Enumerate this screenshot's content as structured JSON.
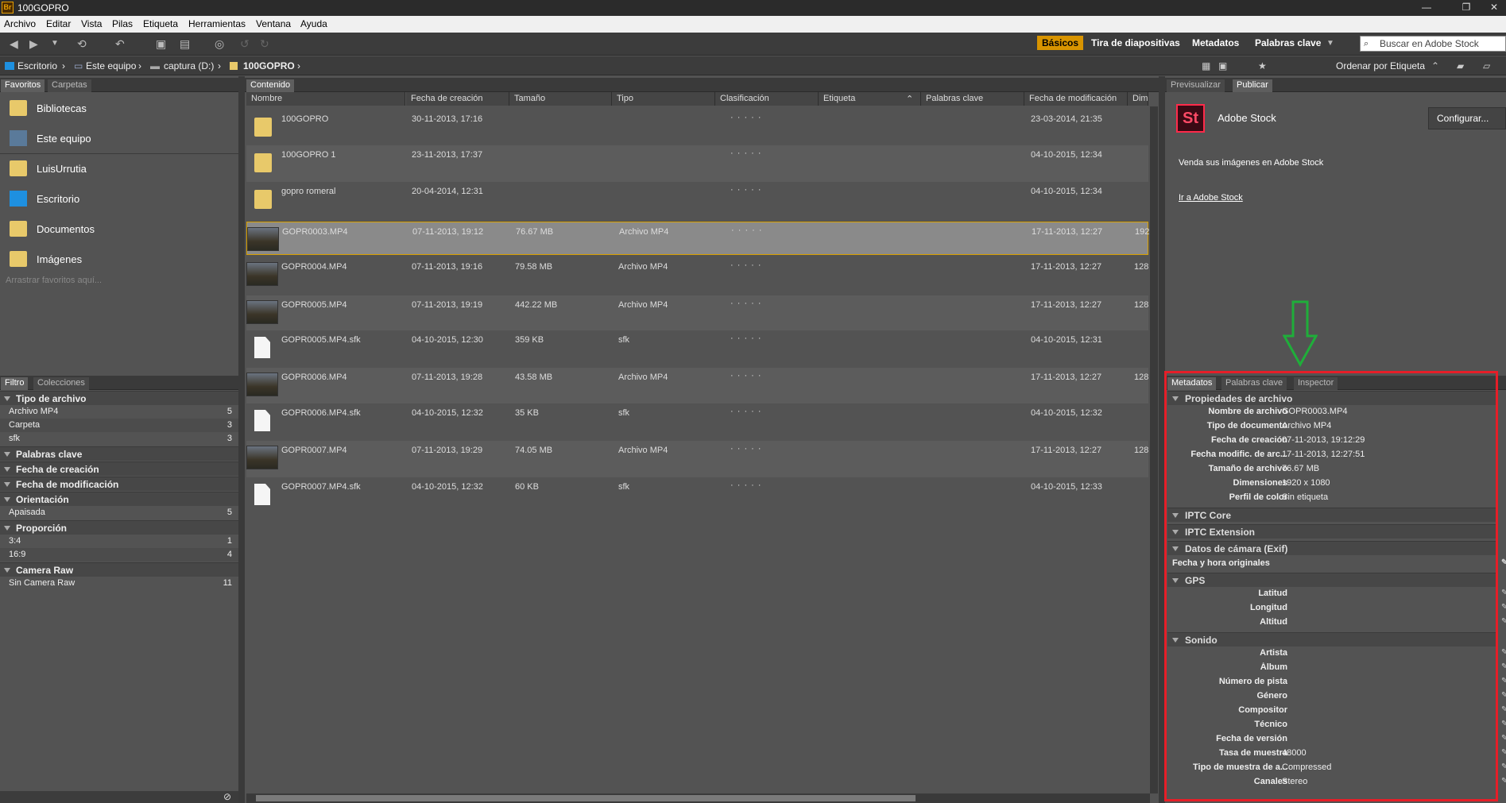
{
  "window": {
    "title": "100GOPRO",
    "logo": "Br"
  },
  "menu": [
    "Archivo",
    "Editar",
    "Vista",
    "Pilas",
    "Etiqueta",
    "Herramientas",
    "Ventana",
    "Ayuda"
  ],
  "workspaces": {
    "basicos": "Básicos",
    "tira": "Tira de diapositivas",
    "metadatos": "Metadatos",
    "palabras": "Palabras clave"
  },
  "search": {
    "placeholder": "Buscar en Adobe Stock"
  },
  "path": [
    "Escritorio",
    "Este equipo",
    "captura (D:)",
    "100GOPRO"
  ],
  "sort": {
    "label": "Ordenar por Etiqueta"
  },
  "left_tabs": {
    "favoritos": "Favoritos",
    "carpetas": "Carpetas"
  },
  "favorites": [
    "Bibliotecas",
    "Este equipo",
    "LuisUrrutia",
    "Escritorio",
    "Documentos",
    "Imágenes"
  ],
  "favorites_hint": "Arrastrar favoritos aquí...",
  "filter_tabs": {
    "filtro": "Filtro",
    "colecciones": "Colecciones"
  },
  "filter": {
    "tipo": {
      "head": "Tipo de archivo",
      "rows": [
        [
          "Archivo MP4",
          "5"
        ],
        [
          "Carpeta",
          "3"
        ],
        [
          "sfk",
          "3"
        ]
      ]
    },
    "palabras": "Palabras clave",
    "creacion": "Fecha de creación",
    "modificacion": "Fecha de modificación",
    "orientacion": {
      "head": "Orientación",
      "rows": [
        [
          "Apaisada",
          "5"
        ]
      ]
    },
    "proporcion": {
      "head": "Proporción",
      "rows": [
        [
          "3:4",
          "1"
        ],
        [
          "16:9",
          "4"
        ]
      ]
    },
    "raw": {
      "head": "Camera Raw",
      "rows": [
        [
          "Sin Camera Raw",
          "11"
        ]
      ]
    }
  },
  "content_tab": "Contenido",
  "columns": [
    "Nombre",
    "Fecha de creación",
    "Tamaño",
    "Tipo",
    "Clasificación",
    "Etiqueta",
    "Palabras clave",
    "Fecha de modificación",
    "Dimens"
  ],
  "rating_dots": "· · · · ·",
  "files": [
    {
      "name": "100GOPRO",
      "created": "30-11-2013, 17:16",
      "size": "",
      "type": "",
      "modified": "23-03-2014, 21:35",
      "dim": "",
      "kind": "folder"
    },
    {
      "name": "100GOPRO 1",
      "created": "23-11-2013, 17:37",
      "size": "",
      "type": "",
      "modified": "04-10-2015, 12:34",
      "dim": "",
      "kind": "folder"
    },
    {
      "name": "gopro romeral",
      "created": "20-04-2014, 12:31",
      "size": "",
      "type": "",
      "modified": "04-10-2015, 12:34",
      "dim": "",
      "kind": "folder"
    },
    {
      "name": "GOPR0003.MP4",
      "created": "07-11-2013, 19:12",
      "size": "76.67 MB",
      "type": "Archivo MP4",
      "modified": "17-11-2013, 12:27",
      "dim": "192",
      "kind": "video"
    },
    {
      "name": "GOPR0004.MP4",
      "created": "07-11-2013, 19:16",
      "size": "79.58 MB",
      "type": "Archivo MP4",
      "modified": "17-11-2013, 12:27",
      "dim": "128",
      "kind": "video"
    },
    {
      "name": "GOPR0005.MP4",
      "created": "07-11-2013, 19:19",
      "size": "442.22 MB",
      "type": "Archivo MP4",
      "modified": "17-11-2013, 12:27",
      "dim": "128",
      "kind": "video"
    },
    {
      "name": "GOPR0005.MP4.sfk",
      "created": "04-10-2015, 12:30",
      "size": "359 KB",
      "type": "sfk",
      "modified": "04-10-2015, 12:31",
      "dim": "",
      "kind": "doc"
    },
    {
      "name": "GOPR0006.MP4",
      "created": "07-11-2013, 19:28",
      "size": "43.58 MB",
      "type": "Archivo MP4",
      "modified": "17-11-2013, 12:27",
      "dim": "128",
      "kind": "video"
    },
    {
      "name": "GOPR0006.MP4.sfk",
      "created": "04-10-2015, 12:32",
      "size": "35 KB",
      "type": "sfk",
      "modified": "04-10-2015, 12:32",
      "dim": "",
      "kind": "doc"
    },
    {
      "name": "GOPR0007.MP4",
      "created": "07-11-2013, 19:29",
      "size": "74.05 MB",
      "type": "Archivo MP4",
      "modified": "17-11-2013, 12:27",
      "dim": "128",
      "kind": "video"
    },
    {
      "name": "GOPR0007.MP4.sfk",
      "created": "04-10-2015, 12:32",
      "size": "60 KB",
      "type": "sfk",
      "modified": "04-10-2015, 12:33",
      "dim": "",
      "kind": "doc"
    }
  ],
  "right_tabs": {
    "previsualizar": "Previsualizar",
    "publicar": "Publicar"
  },
  "stock": {
    "icon": "St",
    "name": "Adobe Stock",
    "configure": "Configurar...",
    "sell": "Venda sus imágenes en Adobe Stock",
    "link": "Ir a Adobe Stock"
  },
  "meta_tabs": {
    "metadatos": "Metadatos",
    "palabras": "Palabras clave",
    "inspector": "Inspector"
  },
  "meta": {
    "props_head": "Propiedades de archivo",
    "props": [
      [
        "Nombre de archivo",
        "GOPR0003.MP4"
      ],
      [
        "Tipo de documento",
        "Archivo MP4"
      ],
      [
        "Fecha de creación",
        "07-11-2013, 19:12:29"
      ],
      [
        "Fecha modific. de arc...",
        "17-11-2013, 12:27:51"
      ],
      [
        "Tamaño de archivo",
        "76.67 MB"
      ],
      [
        "Dimensiones",
        "1920 x 1080"
      ],
      [
        "Perfil de color",
        "Sin etiqueta"
      ]
    ],
    "iptc_core": "IPTC Core",
    "iptc_ext": "IPTC Extension",
    "exif_head": "Datos de cámara (Exif)",
    "exif_row": "Fecha y hora originales",
    "gps_head": "GPS",
    "gps": [
      "Latitud",
      "Longitud",
      "Altitud"
    ],
    "sonido_head": "Sonido",
    "sonido": [
      [
        "Artista",
        ""
      ],
      [
        "Álbum",
        ""
      ],
      [
        "Número de pista",
        ""
      ],
      [
        "Género",
        ""
      ],
      [
        "Compositor",
        ""
      ],
      [
        "Técnico",
        ""
      ],
      [
        "Fecha de versión",
        ""
      ],
      [
        "Tasa de muestra",
        "48000"
      ],
      [
        "Tipo de muestra de a...",
        "Compressed"
      ],
      [
        "Canales",
        "Stereo"
      ]
    ]
  },
  "colors": {
    "accent": "#d89400",
    "highlight": "#e61e28",
    "arrow": "#1fae3a",
    "selection": "#8a8a8a"
  }
}
